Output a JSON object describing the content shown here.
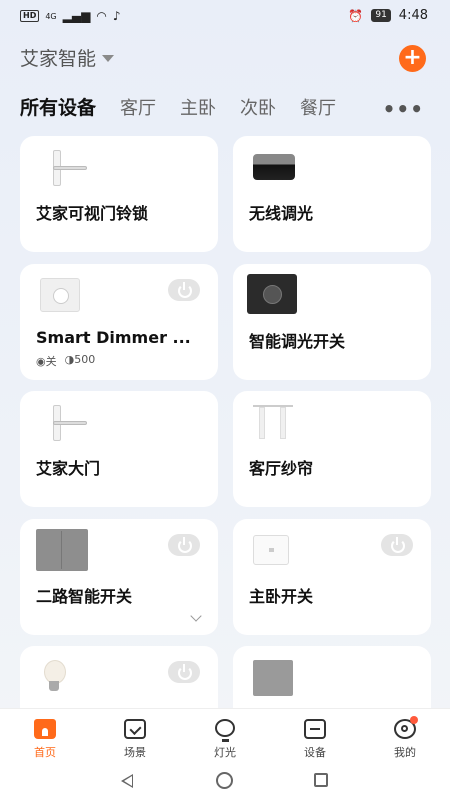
{
  "status_bar": {
    "network_tag": "HD",
    "signal": "4G",
    "battery": "91",
    "time": "4:48"
  },
  "header": {
    "home_name": "艾家智能",
    "add_icon": "plus-icon"
  },
  "tabs": [
    "所有设备",
    "客厅",
    "主卧",
    "次卧",
    "餐厅"
  ],
  "more_label": "•••",
  "devices": [
    {
      "name": "艾家可视门铃锁",
      "image": "smart-lock"
    },
    {
      "name": "无线调光",
      "image": "wireless-dimmer-hub"
    },
    {
      "name": "Smart Dimmer ...",
      "image": "dimmer-switch",
      "status_power": "关",
      "status_brightness": "500"
    },
    {
      "name": "智能调光开关",
      "image": "black-knob-dimmer"
    },
    {
      "name": "艾家大门",
      "image": "smart-lock"
    },
    {
      "name": "客厅纱帘",
      "image": "curtain"
    },
    {
      "name": "二路智能开关",
      "image": "two-gang-switch"
    },
    {
      "name": "主卧开关",
      "image": "single-switch"
    },
    {
      "name": "",
      "image": "light-bulb"
    },
    {
      "name": "",
      "image": "grey-panel"
    }
  ],
  "bottom_nav": [
    {
      "label": "首页",
      "icon": "home-icon"
    },
    {
      "label": "场景",
      "icon": "scene-icon"
    },
    {
      "label": "灯光",
      "icon": "light-icon"
    },
    {
      "label": "设备",
      "icon": "device-icon"
    },
    {
      "label": "我的",
      "icon": "profile-icon"
    }
  ],
  "colors": {
    "accent": "#ff6a1a",
    "card": "#ffffff",
    "background": "#eaf0f8"
  }
}
